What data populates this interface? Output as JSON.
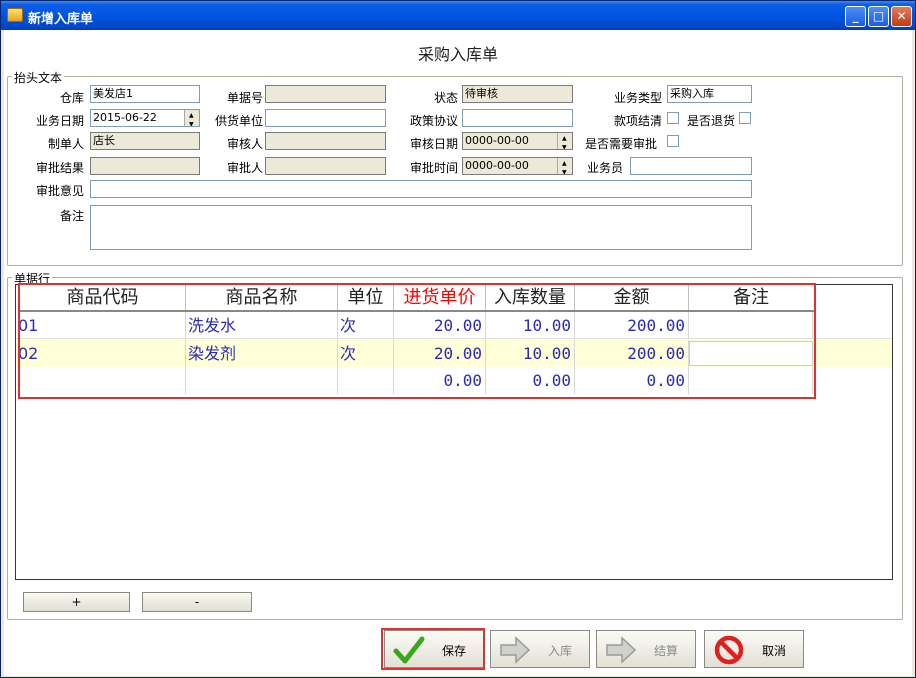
{
  "window": {
    "title": "新增入库单"
  },
  "form": {
    "title": "采购入库单"
  },
  "header_group": {
    "label": "抬头文本"
  },
  "fields": {
    "warehouse": {
      "label": "仓库",
      "value": "美发店1"
    },
    "doc_no": {
      "label": "单据号",
      "value": ""
    },
    "status": {
      "label": "状态",
      "value": "待审核"
    },
    "biz_type": {
      "label": "业务类型",
      "value": "采购入库"
    },
    "biz_date": {
      "label": "业务日期",
      "value": "2015-06-22"
    },
    "supplier": {
      "label": "供货单位",
      "value": ""
    },
    "policy": {
      "label": "政策协议",
      "value": ""
    },
    "settled": {
      "label": "款项结清"
    },
    "returned": {
      "label": "是否退货"
    },
    "creator": {
      "label": "制单人",
      "value": "店长"
    },
    "auditor": {
      "label": "审核人",
      "value": ""
    },
    "audit_date": {
      "label": "审核日期",
      "value": "0000-00-00"
    },
    "need_approve": {
      "label": "是否需要审批"
    },
    "approve_result": {
      "label": "审批结果",
      "value": ""
    },
    "approver": {
      "label": "审批人",
      "value": ""
    },
    "approve_time": {
      "label": "审批时间",
      "value": "0000-00-00"
    },
    "salesman": {
      "label": "业务员",
      "value": ""
    },
    "approve_opinion": {
      "label": "审批意见",
      "value": ""
    },
    "remark": {
      "label": "备注",
      "value": ""
    }
  },
  "lines_group": {
    "label": "单据行"
  },
  "grid": {
    "columns": [
      "商品代码",
      "商品名称",
      "单位",
      "进货单价",
      "入库数量",
      "金额",
      "备注"
    ],
    "rows": [
      {
        "code": "01",
        "name": "洗发水",
        "unit": "次",
        "price": "20.00",
        "qty": "10.00",
        "amount": "200.00",
        "note": ""
      },
      {
        "code": "02",
        "name": "染发剂",
        "unit": "次",
        "price": "20.00",
        "qty": "10.00",
        "amount": "200.00",
        "note": ""
      },
      {
        "code": "",
        "name": "",
        "unit": "",
        "price": "0.00",
        "qty": "0.00",
        "amount": "0.00",
        "note": ""
      }
    ],
    "highlight_color": "#ffffd8"
  },
  "row_buttons": {
    "add": "+",
    "remove": "-"
  },
  "buttons": {
    "save": "保存",
    "stock_in": "入库",
    "settle": "结算",
    "cancel": "取消"
  }
}
